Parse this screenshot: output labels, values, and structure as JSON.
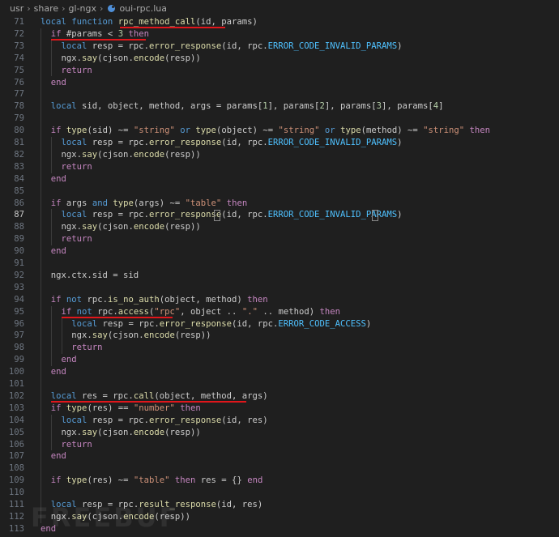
{
  "breadcrumb": [
    "usr",
    "share",
    "gl-ngx",
    "oui-rpc.lua"
  ],
  "file_icon": "lua-file-icon",
  "active_line": 87,
  "watermark": "FREEBUF",
  "colors": {
    "background": "#1f1f1f",
    "keyword": "#569cd6",
    "control": "#c586c0",
    "function": "#dcdcaa",
    "string": "#ce9178",
    "number": "#b5cea8",
    "constant": "#4fc1ff",
    "annotation": "#e0161b"
  },
  "lines": [
    {
      "n": 71,
      "tokens": [
        [
          "local",
          "kw"
        ],
        [
          " "
        ],
        [
          "function",
          "kw"
        ],
        [
          " "
        ],
        [
          "rpc_method_call",
          "fn"
        ],
        [
          "(id, params)"
        ]
      ]
    },
    {
      "n": 72,
      "tokens": [
        [
          "  "
        ],
        [
          "if",
          "ct"
        ],
        [
          " #params < "
        ],
        [
          "3",
          "num"
        ],
        [
          " "
        ],
        [
          "then",
          "ct"
        ]
      ]
    },
    {
      "n": 73,
      "tokens": [
        [
          "    "
        ],
        [
          "local",
          "kw"
        ],
        [
          " resp = rpc."
        ],
        [
          "error_response",
          "fn"
        ],
        [
          "(id, rpc."
        ],
        [
          "ERROR_CODE_INVALID_PARAMS",
          "cn"
        ],
        [
          ")"
        ]
      ]
    },
    {
      "n": 74,
      "tokens": [
        [
          "    ngx."
        ],
        [
          "say",
          "fn"
        ],
        [
          "(cjson."
        ],
        [
          "encode",
          "fn"
        ],
        [
          "(resp))"
        ]
      ]
    },
    {
      "n": 75,
      "tokens": [
        [
          "    "
        ],
        [
          "return",
          "ct"
        ]
      ]
    },
    {
      "n": 76,
      "tokens": [
        [
          "  "
        ],
        [
          "end",
          "ct"
        ]
      ]
    },
    {
      "n": 77,
      "tokens": []
    },
    {
      "n": 78,
      "tokens": [
        [
          "  "
        ],
        [
          "local",
          "kw"
        ],
        [
          " sid, object, method, args = params["
        ],
        [
          "1",
          "num"
        ],
        [
          "], params["
        ],
        [
          "2",
          "num"
        ],
        [
          "], params["
        ],
        [
          "3",
          "num"
        ],
        [
          "], params["
        ],
        [
          "4",
          "num"
        ],
        [
          "]"
        ]
      ]
    },
    {
      "n": 79,
      "tokens": []
    },
    {
      "n": 80,
      "tokens": [
        [
          "  "
        ],
        [
          "if",
          "ct"
        ],
        [
          " "
        ],
        [
          "type",
          "fn"
        ],
        [
          "(sid) ~= "
        ],
        [
          "\"string\"",
          "str"
        ],
        [
          " "
        ],
        [
          "or",
          "kw"
        ],
        [
          " "
        ],
        [
          "type",
          "fn"
        ],
        [
          "(object) ~= "
        ],
        [
          "\"string\"",
          "str"
        ],
        [
          " "
        ],
        [
          "or",
          "kw"
        ],
        [
          " "
        ],
        [
          "type",
          "fn"
        ],
        [
          "(method) ~= "
        ],
        [
          "\"string\"",
          "str"
        ],
        [
          " "
        ],
        [
          "then",
          "ct"
        ]
      ]
    },
    {
      "n": 81,
      "tokens": [
        [
          "    "
        ],
        [
          "local",
          "kw"
        ],
        [
          " resp = rpc."
        ],
        [
          "error_response",
          "fn"
        ],
        [
          "(id, rpc."
        ],
        [
          "ERROR_CODE_INVALID_PARAMS",
          "cn"
        ],
        [
          ")"
        ]
      ]
    },
    {
      "n": 82,
      "tokens": [
        [
          "    ngx."
        ],
        [
          "say",
          "fn"
        ],
        [
          "(cjson."
        ],
        [
          "encode",
          "fn"
        ],
        [
          "(resp))"
        ]
      ]
    },
    {
      "n": 83,
      "tokens": [
        [
          "    "
        ],
        [
          "return",
          "ct"
        ]
      ]
    },
    {
      "n": 84,
      "tokens": [
        [
          "  "
        ],
        [
          "end",
          "ct"
        ]
      ]
    },
    {
      "n": 85,
      "tokens": []
    },
    {
      "n": 86,
      "tokens": [
        [
          "  "
        ],
        [
          "if",
          "ct"
        ],
        [
          " args "
        ],
        [
          "and",
          "kw"
        ],
        [
          " "
        ],
        [
          "type",
          "fn"
        ],
        [
          "(args) ~= "
        ],
        [
          "\"table\"",
          "str"
        ],
        [
          " "
        ],
        [
          "then",
          "ct"
        ]
      ]
    },
    {
      "n": 87,
      "tokens": [
        [
          "    "
        ],
        [
          "local",
          "kw"
        ],
        [
          " resp = rpc."
        ],
        [
          "error_response",
          "fn"
        ],
        [
          "(id, rpc."
        ],
        [
          "ERROR_CODE_INVALID_PARAMS",
          "cn"
        ],
        [
          ")"
        ]
      ]
    },
    {
      "n": 88,
      "tokens": [
        [
          "    ngx."
        ],
        [
          "say",
          "fn"
        ],
        [
          "(cjson."
        ],
        [
          "encode",
          "fn"
        ],
        [
          "(resp))"
        ]
      ]
    },
    {
      "n": 89,
      "tokens": [
        [
          "    "
        ],
        [
          "return",
          "ct"
        ]
      ]
    },
    {
      "n": 90,
      "tokens": [
        [
          "  "
        ],
        [
          "end",
          "ct"
        ]
      ]
    },
    {
      "n": 91,
      "tokens": []
    },
    {
      "n": 92,
      "tokens": [
        [
          "  ngx.ctx.sid = sid"
        ]
      ]
    },
    {
      "n": 93,
      "tokens": []
    },
    {
      "n": 94,
      "tokens": [
        [
          "  "
        ],
        [
          "if",
          "ct"
        ],
        [
          " "
        ],
        [
          "not",
          "kw"
        ],
        [
          " rpc."
        ],
        [
          "is_no_auth",
          "fn"
        ],
        [
          "(object, method) "
        ],
        [
          "then",
          "ct"
        ]
      ]
    },
    {
      "n": 95,
      "tokens": [
        [
          "    "
        ],
        [
          "if",
          "ct"
        ],
        [
          " "
        ],
        [
          "not",
          "kw"
        ],
        [
          " rpc."
        ],
        [
          "access",
          "fn"
        ],
        [
          "("
        ],
        [
          "\"rpc\"",
          "str"
        ],
        [
          ", object .. "
        ],
        [
          "\".\"",
          "str"
        ],
        [
          " .. method) "
        ],
        [
          "then",
          "ct"
        ]
      ]
    },
    {
      "n": 96,
      "tokens": [
        [
          "      "
        ],
        [
          "local",
          "kw"
        ],
        [
          " resp = rpc."
        ],
        [
          "error_response",
          "fn"
        ],
        [
          "(id, rpc."
        ],
        [
          "ERROR_CODE_ACCESS",
          "cn"
        ],
        [
          ")"
        ]
      ]
    },
    {
      "n": 97,
      "tokens": [
        [
          "      ngx."
        ],
        [
          "say",
          "fn"
        ],
        [
          "(cjson."
        ],
        [
          "encode",
          "fn"
        ],
        [
          "(resp))"
        ]
      ]
    },
    {
      "n": 98,
      "tokens": [
        [
          "      "
        ],
        [
          "return",
          "ct"
        ]
      ]
    },
    {
      "n": 99,
      "tokens": [
        [
          "    "
        ],
        [
          "end",
          "ct"
        ]
      ]
    },
    {
      "n": 100,
      "tokens": [
        [
          "  "
        ],
        [
          "end",
          "ct"
        ]
      ]
    },
    {
      "n": 101,
      "tokens": []
    },
    {
      "n": 102,
      "tokens": [
        [
          "  "
        ],
        [
          "local",
          "kw"
        ],
        [
          " res = rpc."
        ],
        [
          "call",
          "fn"
        ],
        [
          "(object, method, args)"
        ]
      ]
    },
    {
      "n": 103,
      "tokens": [
        [
          "  "
        ],
        [
          "if",
          "ct"
        ],
        [
          " "
        ],
        [
          "type",
          "fn"
        ],
        [
          "(res) == "
        ],
        [
          "\"number\"",
          "str"
        ],
        [
          " "
        ],
        [
          "then",
          "ct"
        ]
      ]
    },
    {
      "n": 104,
      "tokens": [
        [
          "    "
        ],
        [
          "local",
          "kw"
        ],
        [
          " resp = rpc."
        ],
        [
          "error_response",
          "fn"
        ],
        [
          "(id, res)"
        ]
      ]
    },
    {
      "n": 105,
      "tokens": [
        [
          "    ngx."
        ],
        [
          "say",
          "fn"
        ],
        [
          "(cjson."
        ],
        [
          "encode",
          "fn"
        ],
        [
          "(resp))"
        ]
      ]
    },
    {
      "n": 106,
      "tokens": [
        [
          "    "
        ],
        [
          "return",
          "ct"
        ]
      ]
    },
    {
      "n": 107,
      "tokens": [
        [
          "  "
        ],
        [
          "end",
          "ct"
        ]
      ]
    },
    {
      "n": 108,
      "tokens": []
    },
    {
      "n": 109,
      "tokens": [
        [
          "  "
        ],
        [
          "if",
          "ct"
        ],
        [
          " "
        ],
        [
          "type",
          "fn"
        ],
        [
          "(res) ~= "
        ],
        [
          "\"table\"",
          "str"
        ],
        [
          " "
        ],
        [
          "then",
          "ct"
        ],
        [
          " res = {} "
        ],
        [
          "end",
          "ct"
        ]
      ]
    },
    {
      "n": 110,
      "tokens": []
    },
    {
      "n": 111,
      "tokens": [
        [
          "  "
        ],
        [
          "local",
          "kw"
        ],
        [
          " resp = rpc."
        ],
        [
          "result_response",
          "fn"
        ],
        [
          "(id, res)"
        ]
      ]
    },
    {
      "n": 112,
      "tokens": [
        [
          "  ngx."
        ],
        [
          "say",
          "fn"
        ],
        [
          "(cjson."
        ],
        [
          "encode",
          "fn"
        ],
        [
          "(resp))"
        ]
      ]
    },
    {
      "n": 113,
      "tokens": [
        [
          "end",
          "ct"
        ]
      ]
    }
  ]
}
